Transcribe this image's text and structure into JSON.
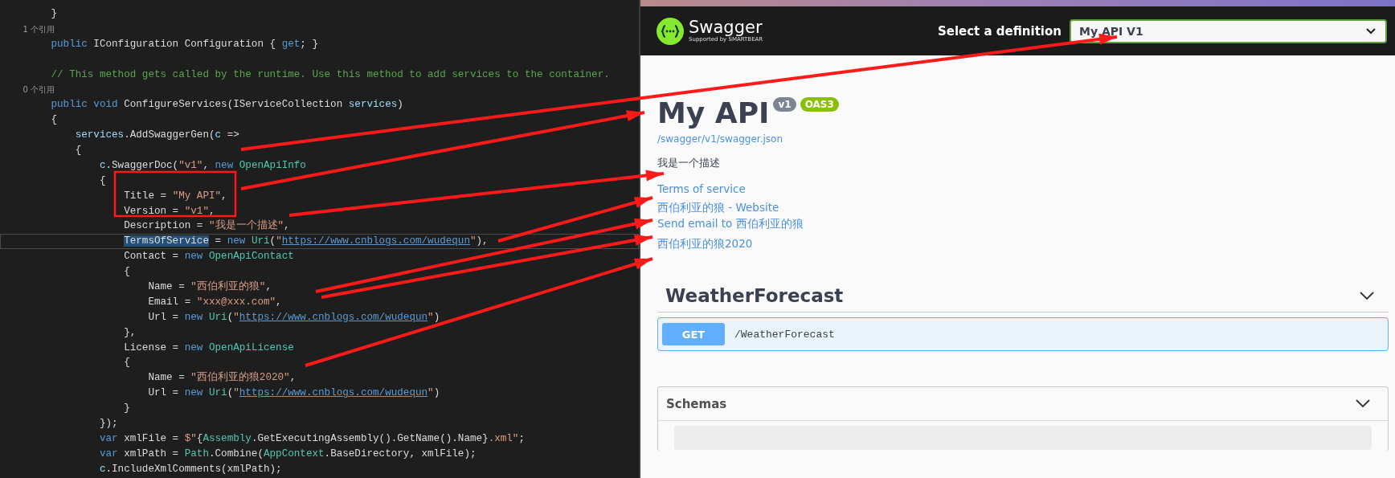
{
  "editor": {
    "lines": [
      {
        "kind": "code",
        "tokens": [
          {
            "kind": "plain",
            "text": "        }"
          }
        ]
      },
      {
        "kind": "ref",
        "tokens": [
          {
            "kind": "plain",
            "text": "        1 个引用"
          }
        ]
      },
      {
        "kind": "code",
        "tokens": [
          {
            "kind": "kw",
            "text": "        public"
          },
          {
            "kind": "plain",
            "text": " IConfiguration Configuration { "
          },
          {
            "kind": "kw",
            "text": "get"
          },
          {
            "kind": "plain",
            "text": "; }"
          }
        ]
      },
      {
        "kind": "blank"
      },
      {
        "kind": "code",
        "tokens": [
          {
            "kind": "cm",
            "text": "        // This method gets called by the runtime. Use this method to add services to the container."
          }
        ]
      },
      {
        "kind": "ref",
        "tokens": [
          {
            "kind": "plain",
            "text": "        0 个引用"
          }
        ]
      },
      {
        "kind": "code",
        "tokens": [
          {
            "kind": "kw",
            "text": "        public void"
          },
          {
            "kind": "plain",
            "text": " ConfigureServices(IServiceCollection "
          },
          {
            "kind": "var",
            "text": "services"
          },
          {
            "kind": "plain",
            "text": ")"
          }
        ]
      },
      {
        "kind": "code",
        "tokens": [
          {
            "kind": "plain",
            "text": "        {"
          }
        ]
      },
      {
        "kind": "code",
        "tokens": [
          {
            "kind": "var",
            "text": "            services"
          },
          {
            "kind": "plain",
            "text": ".AddSwaggerGen("
          },
          {
            "kind": "var",
            "text": "c"
          },
          {
            "kind": "plain",
            "text": " =>"
          }
        ]
      },
      {
        "kind": "code",
        "tokens": [
          {
            "kind": "plain",
            "text": "            {"
          }
        ]
      },
      {
        "kind": "code",
        "tokens": [
          {
            "kind": "var",
            "text": "                c"
          },
          {
            "kind": "plain",
            "text": ".SwaggerDoc("
          },
          {
            "kind": "str",
            "text": "\"v1\""
          },
          {
            "kind": "plain",
            "text": ", "
          },
          {
            "kind": "kw",
            "text": "new"
          },
          {
            "kind": "type",
            "text": " OpenApiInfo"
          }
        ]
      },
      {
        "kind": "code",
        "tokens": [
          {
            "kind": "plain",
            "text": "                {"
          }
        ]
      },
      {
        "kind": "code",
        "tokens": [
          {
            "kind": "plain",
            "text": "                    Title = "
          },
          {
            "kind": "str",
            "text": "\"My API\""
          },
          {
            "kind": "plain",
            "text": ","
          }
        ]
      },
      {
        "kind": "code",
        "tokens": [
          {
            "kind": "plain",
            "text": "                    Version = "
          },
          {
            "kind": "str",
            "text": "\"v1\""
          },
          {
            "kind": "plain",
            "text": ","
          }
        ]
      },
      {
        "kind": "code",
        "tokens": [
          {
            "kind": "plain",
            "text": "                    Description = "
          },
          {
            "kind": "str",
            "text": "\"我是一个描述\""
          },
          {
            "kind": "plain",
            "text": ","
          }
        ]
      },
      {
        "kind": "current",
        "tokens": [
          {
            "kind": "sel",
            "text": "                    TermsOfService"
          },
          {
            "kind": "plain",
            "text": " = "
          },
          {
            "kind": "kw",
            "text": "new"
          },
          {
            "kind": "type",
            "text": " Uri"
          },
          {
            "kind": "plain",
            "text": "("
          },
          {
            "kind": "str",
            "text": "\""
          },
          {
            "kind": "link",
            "text": "https://www.cnblogs.com/wudequn"
          },
          {
            "kind": "str",
            "text": "\""
          },
          {
            "kind": "plain",
            "text": "),"
          }
        ]
      },
      {
        "kind": "code",
        "tokens": [
          {
            "kind": "plain",
            "text": "                    Contact = "
          },
          {
            "kind": "kw",
            "text": "new"
          },
          {
            "kind": "type",
            "text": " OpenApiContact"
          }
        ]
      },
      {
        "kind": "code",
        "tokens": [
          {
            "kind": "plain",
            "text": "                    {"
          }
        ]
      },
      {
        "kind": "code",
        "tokens": [
          {
            "kind": "plain",
            "text": "                        Name = "
          },
          {
            "kind": "str",
            "text": "\"西伯利亚的狼\""
          },
          {
            "kind": "plain",
            "text": ","
          }
        ]
      },
      {
        "kind": "code",
        "tokens": [
          {
            "kind": "plain",
            "text": "                        Email = "
          },
          {
            "kind": "str",
            "text": "\"xxx@xxx.com\""
          },
          {
            "kind": "plain",
            "text": ","
          }
        ]
      },
      {
        "kind": "code",
        "tokens": [
          {
            "kind": "plain",
            "text": "                        Url = "
          },
          {
            "kind": "kw",
            "text": "new"
          },
          {
            "kind": "type",
            "text": " Uri"
          },
          {
            "kind": "plain",
            "text": "("
          },
          {
            "kind": "str",
            "text": "\""
          },
          {
            "kind": "link",
            "text": "https://www.cnblogs.com/wudequn"
          },
          {
            "kind": "str",
            "text": "\""
          },
          {
            "kind": "plain",
            "text": ")"
          }
        ]
      },
      {
        "kind": "code",
        "tokens": [
          {
            "kind": "plain",
            "text": "                    },"
          }
        ]
      },
      {
        "kind": "code",
        "tokens": [
          {
            "kind": "plain",
            "text": "                    License = "
          },
          {
            "kind": "kw",
            "text": "new"
          },
          {
            "kind": "type",
            "text": " OpenApiLicense"
          }
        ]
      },
      {
        "kind": "code",
        "tokens": [
          {
            "kind": "plain",
            "text": "                    {"
          }
        ]
      },
      {
        "kind": "code",
        "tokens": [
          {
            "kind": "plain",
            "text": "                        Name = "
          },
          {
            "kind": "str",
            "text": "\"西伯利亚的狼2020\""
          },
          {
            "kind": "plain",
            "text": ","
          }
        ]
      },
      {
        "kind": "code",
        "tokens": [
          {
            "kind": "plain",
            "text": "                        Url = "
          },
          {
            "kind": "kw",
            "text": "new"
          },
          {
            "kind": "type",
            "text": " Uri"
          },
          {
            "kind": "plain",
            "text": "("
          },
          {
            "kind": "str",
            "text": "\""
          },
          {
            "kind": "link",
            "text": "https://www.cnblogs.com/wudequn"
          },
          {
            "kind": "str",
            "text": "\""
          },
          {
            "kind": "plain",
            "text": ")"
          }
        ]
      },
      {
        "kind": "code",
        "tokens": [
          {
            "kind": "plain",
            "text": "                    }"
          }
        ]
      },
      {
        "kind": "code",
        "tokens": [
          {
            "kind": "plain",
            "text": "                });"
          }
        ]
      },
      {
        "kind": "code",
        "tokens": [
          {
            "kind": "kw",
            "text": "                var"
          },
          {
            "kind": "plain",
            "text": " xmlFile = "
          },
          {
            "kind": "str",
            "text": "$\""
          },
          {
            "kind": "plain",
            "text": "{"
          },
          {
            "kind": "type",
            "text": "Assembly"
          },
          {
            "kind": "plain",
            "text": ".GetExecutingAssembly().GetName().Name}"
          },
          {
            "kind": "str",
            "text": ".xml\""
          },
          {
            "kind": "plain",
            "text": ";"
          }
        ]
      },
      {
        "kind": "code",
        "tokens": [
          {
            "kind": "kw",
            "text": "                var"
          },
          {
            "kind": "plain",
            "text": " xmlPath = "
          },
          {
            "kind": "type",
            "text": "Path"
          },
          {
            "kind": "plain",
            "text": ".Combine("
          },
          {
            "kind": "type",
            "text": "AppContext"
          },
          {
            "kind": "plain",
            "text": ".BaseDirectory, xmlFile);"
          }
        ]
      },
      {
        "kind": "code",
        "tokens": [
          {
            "kind": "var",
            "text": "                c"
          },
          {
            "kind": "plain",
            "text": ".IncludeXmlComments(xmlPath);"
          }
        ]
      }
    ]
  },
  "swagger": {
    "logo": {
      "name": "Swagger",
      "tagline": "Supported by SMARTBEAR"
    },
    "definition": {
      "label": "Select a definition",
      "value": "My API V1"
    },
    "info": {
      "title": "My API",
      "version": "v1",
      "spec": "OAS3",
      "url": "/swagger/v1/swagger.json",
      "description": "我是一个描述",
      "links": [
        "Terms of service",
        "西伯利亚的狼 - Website",
        "Send email to 西伯利亚的狼",
        "西伯利亚的狼2020"
      ]
    },
    "tags": [
      {
        "name": "WeatherForecast",
        "expanded": true,
        "operations": [
          {
            "method": "GET",
            "path": "/WeatherForecast"
          }
        ]
      }
    ],
    "schemas": {
      "title": "Schemas",
      "expanded": true
    }
  }
}
